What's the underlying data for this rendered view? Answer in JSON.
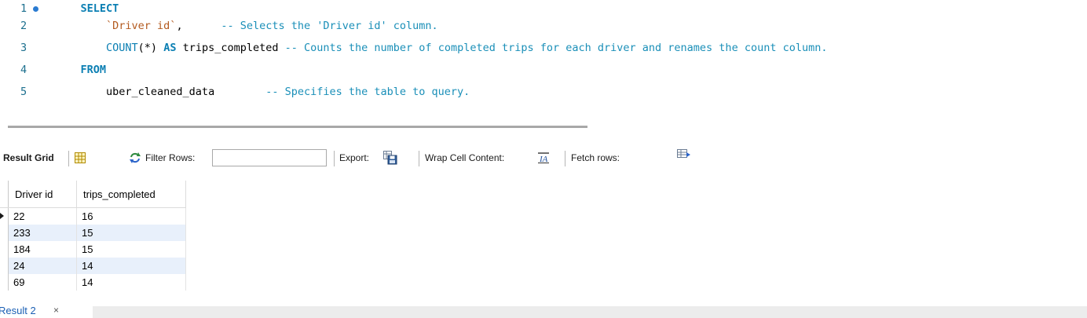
{
  "editor": {
    "lines": [
      {
        "num": "1",
        "has_breakpoint": true,
        "tokens": [
          {
            "cls": "kw",
            "text": "    SELECT"
          }
        ]
      },
      {
        "num": "2",
        "has_breakpoint": false,
        "tokens": [
          {
            "cls": "id",
            "text": "        "
          },
          {
            "cls": "str",
            "text": "`Driver id`"
          },
          {
            "cls": "id",
            "text": ",      "
          },
          {
            "cls": "cm",
            "text": "-- Selects the 'Driver id' column."
          }
        ]
      },
      {
        "num": "3",
        "has_breakpoint": false,
        "tokens": [
          {
            "cls": "id",
            "text": "        "
          },
          {
            "cls": "fn",
            "text": "COUNT"
          },
          {
            "cls": "id",
            "text": "(*) "
          },
          {
            "cls": "kw",
            "text": "AS"
          },
          {
            "cls": "id",
            "text": " trips_completed "
          },
          {
            "cls": "cm",
            "text": "-- Counts the number of completed trips for each driver and renames the count column."
          }
        ]
      },
      {
        "num": "4",
        "has_breakpoint": false,
        "tokens": [
          {
            "cls": "kw",
            "text": "    FROM"
          }
        ]
      },
      {
        "num": "5",
        "has_breakpoint": false,
        "tokens": [
          {
            "cls": "id",
            "text": "        uber_cleaned_data        "
          },
          {
            "cls": "cm",
            "text": "-- Specifies the table to query."
          }
        ]
      }
    ]
  },
  "toolbar": {
    "result_grid_label": "Result Grid",
    "filter_rows_label": "Filter Rows:",
    "filter_value": "",
    "export_label": "Export:",
    "wrap_label": "Wrap Cell Content:",
    "fetch_label": "Fetch rows:"
  },
  "grid": {
    "columns": [
      "Driver id",
      "trips_completed"
    ],
    "rows": [
      [
        "22",
        "16"
      ],
      [
        "233",
        "15"
      ],
      [
        "184",
        "15"
      ],
      [
        "24",
        "14"
      ],
      [
        "69",
        "14"
      ]
    ]
  },
  "tabs": {
    "result_tab_label": "Result 2",
    "close_symbol": "×"
  },
  "colors": {
    "keyword": "#0b7fb3",
    "comment": "#1a8fb8",
    "string": "#b35a1f",
    "row_alt": "#e8f0fb"
  }
}
